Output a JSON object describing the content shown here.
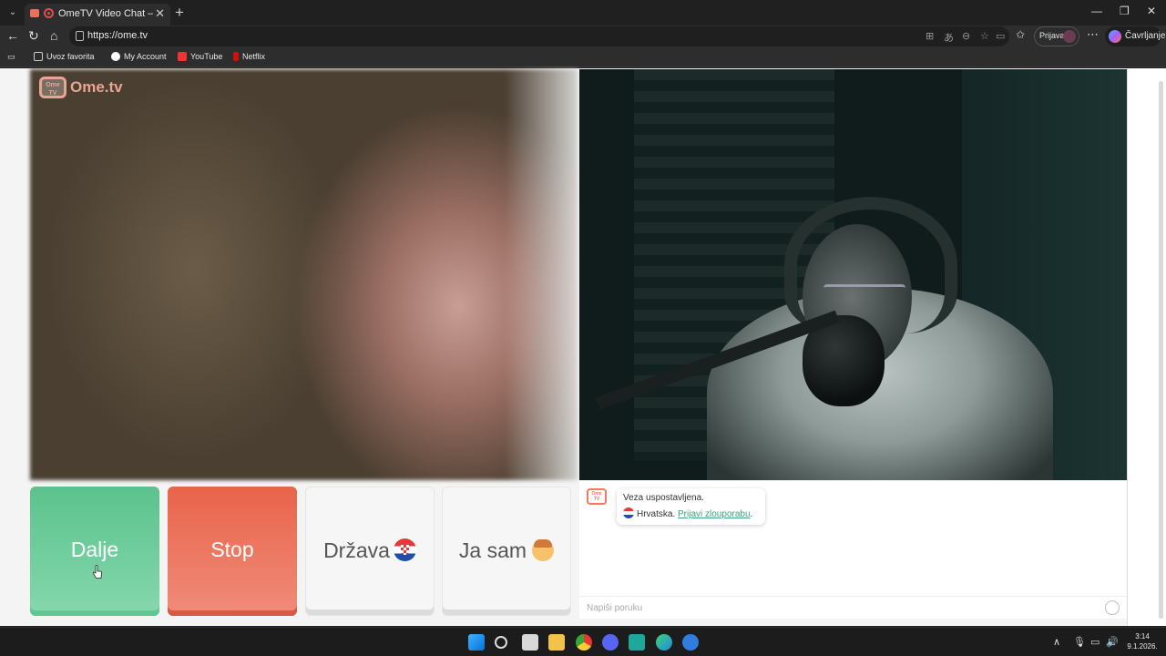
{
  "browser": {
    "tab_title": "OmeTV Video Chat — Omegle",
    "tab_close": "✕",
    "new_tab": "+",
    "url": "https://ome.tv",
    "profile_label": "Prijava",
    "copilot_label": "Čavrljanje",
    "favorites": [
      {
        "label": "Uvoz favorita"
      },
      {
        "label": "My Account"
      },
      {
        "label": "YouTube"
      },
      {
        "label": "Netflix"
      }
    ]
  },
  "site": {
    "logo_small": "Ome TV",
    "logo_text": "Ome.tv"
  },
  "controls": {
    "next_label": "Dalje",
    "stop_label": "Stop",
    "country_label": "Država",
    "gender_label": "Ja sam"
  },
  "chat": {
    "connected_text": "Veza uspostavljena.",
    "country_name": "Hrvatska.",
    "report_link": "Prijavi zlouporabu",
    "report_suffix": ".",
    "input_placeholder": "Napiši poruku"
  },
  "taskbar": {
    "time": "3:14",
    "date": "9.1.2026."
  },
  "colors": {
    "next": "#5bc28d",
    "stop": "#e8644a",
    "brand": "#e8a494",
    "link": "#3aa57a"
  }
}
